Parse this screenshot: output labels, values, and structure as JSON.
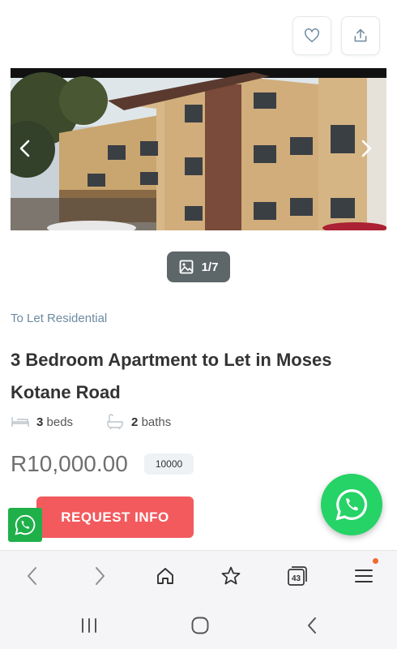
{
  "gallery": {
    "counter": "1/7",
    "prev_icon": "chevron-left-icon",
    "next_icon": "chevron-right-icon"
  },
  "listing": {
    "category": "To Let Residential",
    "title": "3 Bedroom Apartment to Let in Moses Kotane Road",
    "beds_count": "3",
    "beds_label": "beds",
    "baths_count": "2",
    "baths_label": "baths",
    "price": "R10,000.00",
    "price_badge": "10000"
  },
  "actions": {
    "favorite_icon": "heart-icon",
    "share_icon": "share-icon",
    "request_label": "REQUEST INFO"
  },
  "browser": {
    "tabs_count": "43"
  },
  "colors": {
    "accent": "#f25a5e",
    "whatsapp": "#25d366",
    "category": "#6c8aa1"
  }
}
